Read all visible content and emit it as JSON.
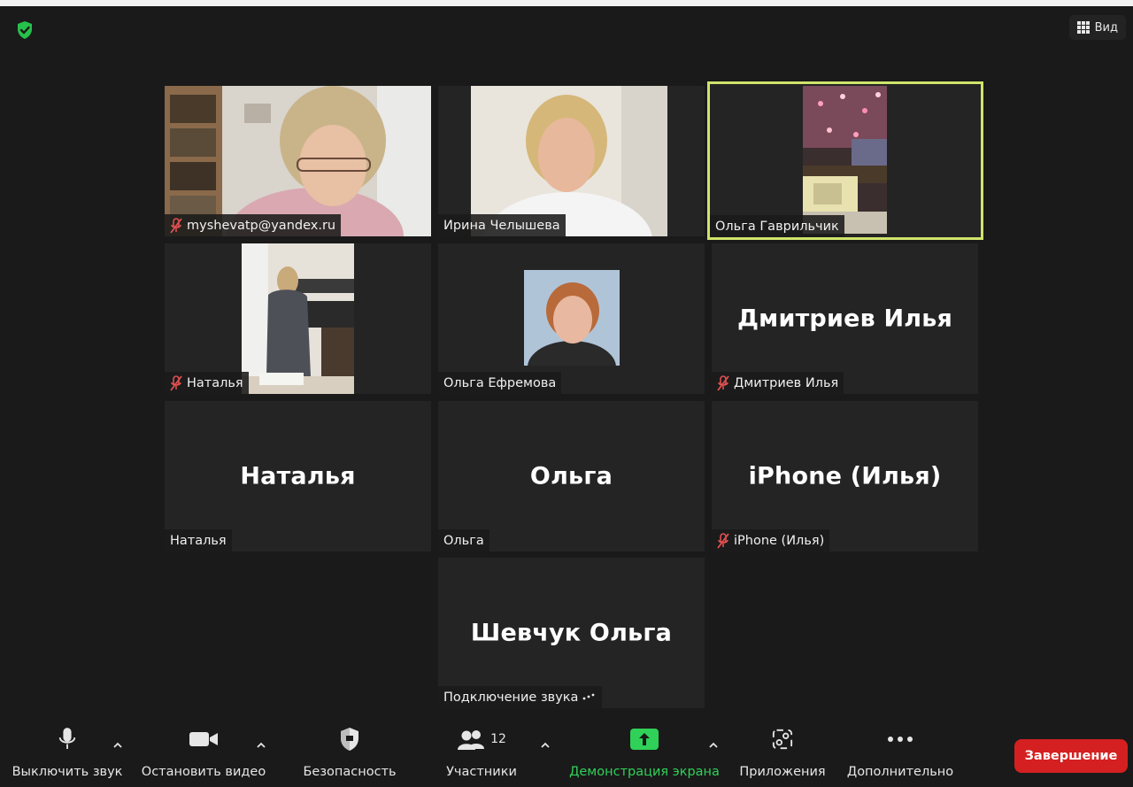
{
  "header": {
    "view_label": "Вид",
    "security_status_icon": "shield-check-icon",
    "colors": {
      "security_green": "#26c04a",
      "active_speaker_border": "#cfe46c"
    }
  },
  "participants": [
    {
      "name": "myshevatp@yandex.ru",
      "muted": true,
      "video": "camera"
    },
    {
      "name": "Ирина Челышева",
      "muted": false,
      "video": "camera"
    },
    {
      "name": "Ольга Гаврильчик",
      "muted": false,
      "video": "camera",
      "active_speaker": true
    },
    {
      "name": "Наталья",
      "muted": true,
      "video": "camera"
    },
    {
      "name": "Ольга Ефремова",
      "muted": false,
      "video": "profile-photo"
    },
    {
      "name": "Дмитриев Илья",
      "display": "Дмитриев Илья",
      "muted": true,
      "video": "off"
    },
    {
      "name": "Наталья",
      "display": "Наталья",
      "muted": false,
      "video": "off"
    },
    {
      "name": "Ольга",
      "display": "Ольга",
      "muted": false,
      "video": "off"
    },
    {
      "name": "iPhone (Илья)",
      "display": "iPhone (Илья)",
      "muted": true,
      "video": "off"
    },
    {
      "name": "Подключение звука",
      "display": "Шевчук Ольга",
      "muted": false,
      "video": "off",
      "connecting_audio": true
    }
  ],
  "toolbar": {
    "mute_label": "Выключить звук",
    "video_label": "Остановить видео",
    "security_label": "Безопасность",
    "participants_label": "Участники",
    "participants_count": "12",
    "share_label": "Демонстрация экрана",
    "apps_label": "Приложения",
    "more_label": "Дополнительно",
    "end_label": "Завершение",
    "colors": {
      "share_green": "#2fd158",
      "end_red": "#d42020"
    }
  }
}
